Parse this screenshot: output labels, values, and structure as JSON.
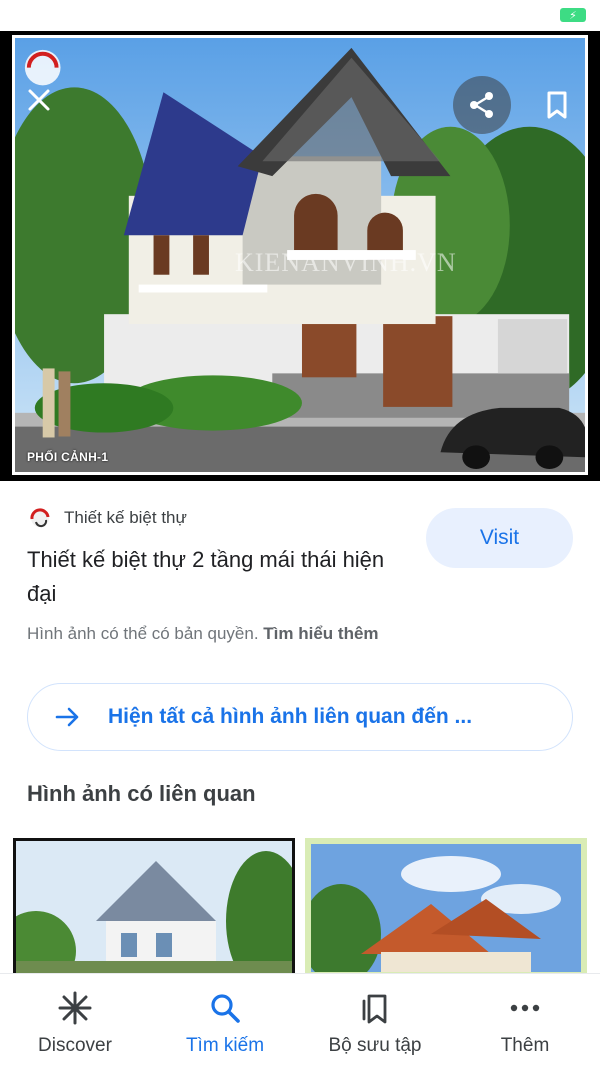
{
  "status_bar": {
    "battery_icon": "battery-charging-icon",
    "battery_color": "#3ddc84"
  },
  "hero": {
    "caption": "PHỐI CẢNH-1",
    "watermark": "KIENANVINH.VN",
    "close_icon": "close-icon",
    "share_icon": "share-icon",
    "bookmark_icon": "bookmark-icon"
  },
  "result": {
    "source_name": "Thiết kế biệt thự",
    "title": "Thiết kế biệt thự 2 tầng mái thái hiện đại",
    "visit_label": "Visit",
    "copyright_text": "Hình ảnh có thể có bản quyền.",
    "learn_more_label": "Tìm hiểu thêm"
  },
  "related": {
    "show_all_label": "Hiện tất cả hình ảnh liên quan đến ...",
    "heading": "Hình ảnh có liên quan"
  },
  "bottom_nav": {
    "items": [
      {
        "label": "Discover",
        "icon": "asterisk-icon",
        "active": false
      },
      {
        "label": "Tìm kiếm",
        "icon": "search-icon",
        "active": true
      },
      {
        "label": "Bộ sưu tập",
        "icon": "collections-icon",
        "active": false
      },
      {
        "label": "Thêm",
        "icon": "more-dots-icon",
        "active": false
      }
    ]
  },
  "colors": {
    "accent": "#1a73e8",
    "visit_bg": "#e8f0fe",
    "text_primary": "#202124",
    "text_secondary": "#70757a"
  }
}
